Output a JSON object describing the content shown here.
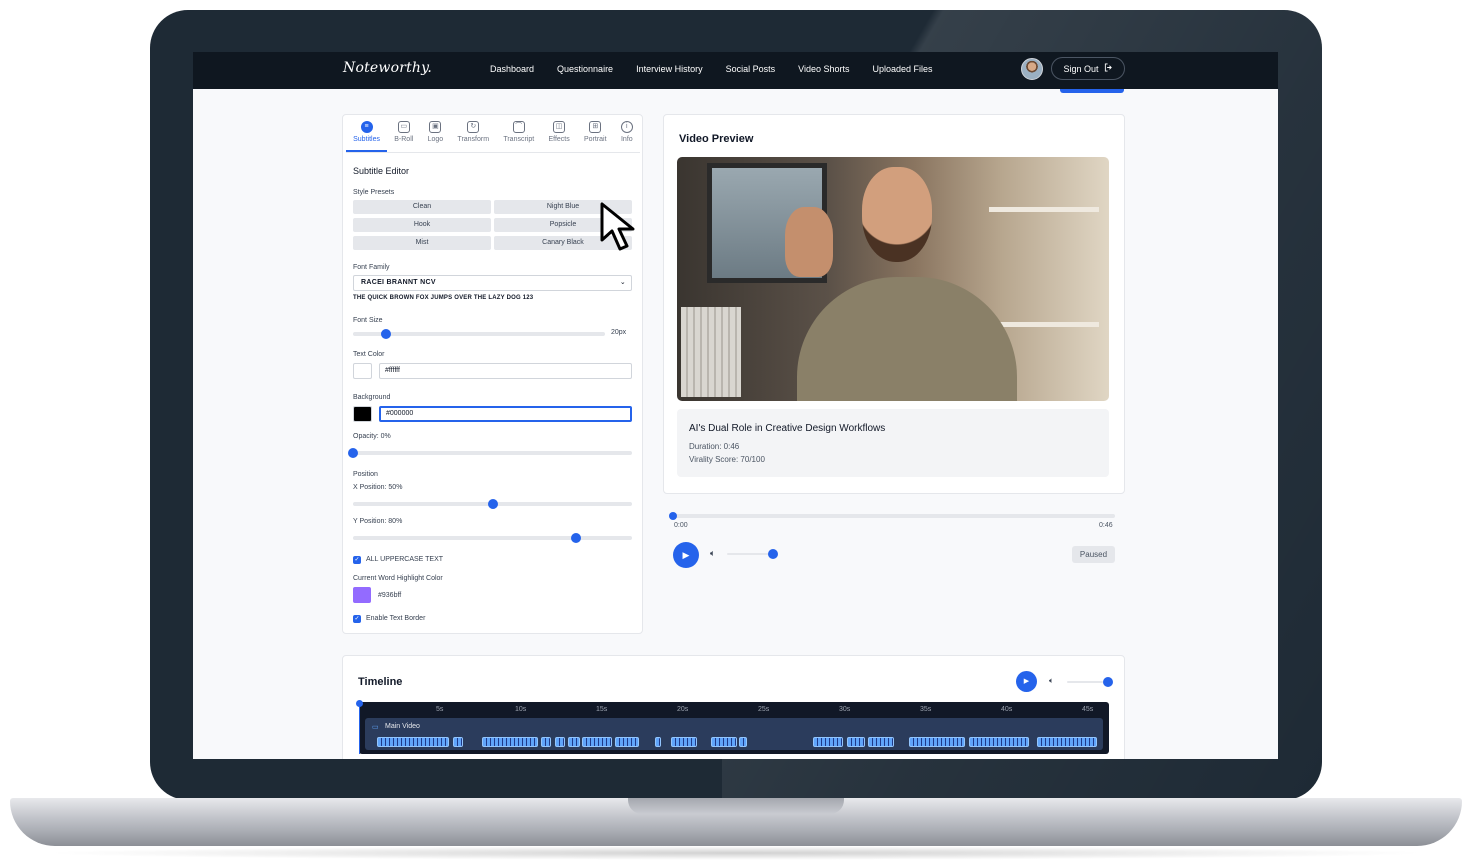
{
  "app": {
    "logo": "Noteworthy."
  },
  "nav": {
    "links": [
      "Dashboard",
      "Questionnaire",
      "Interview History",
      "Social Posts",
      "Video Shorts",
      "Uploaded Files"
    ],
    "sign_out": "Sign Out",
    "sign_out_icon": "logout-icon"
  },
  "tabs": [
    {
      "label": "Subtitles",
      "icon": "subtitles-icon",
      "active": true
    },
    {
      "label": "B-Roll",
      "icon": "camera-icon"
    },
    {
      "label": "Logo",
      "icon": "image-icon"
    },
    {
      "label": "Transform",
      "icon": "rotate-icon"
    },
    {
      "label": "Transcript",
      "icon": "transcript-icon"
    },
    {
      "label": "Effects",
      "icon": "effects-icon"
    },
    {
      "label": "Portrait",
      "icon": "grid-icon"
    },
    {
      "label": "Info",
      "icon": "info-icon"
    }
  ],
  "subtitle_editor": {
    "title": "Subtitle Editor",
    "style_presets_label": "Style Presets",
    "presets": [
      "Clean",
      "Night Blue",
      "Hook",
      "Popsicle",
      "Mist",
      "Canary Black"
    ],
    "font_family_label": "Font Family",
    "font_family_value": "RACEI BRANNT NCV",
    "font_sample": "THE QUICK BROWN FOX JUMPS OVER THE LAZY DOG 123",
    "font_size_label": "Font Size",
    "font_size_value": "20px",
    "font_size_fraction": 0.13,
    "text_color_label": "Text Color",
    "text_color_value": "#ffffff",
    "background_label": "Background",
    "background_value": "#000000",
    "opacity_label": "Opacity: 0%",
    "opacity_fraction": 0,
    "position_label": "Position",
    "x_position_label": "X Position: 50%",
    "x_position_fraction": 0.5,
    "y_position_label": "Y Position: 80%",
    "y_position_fraction": 0.8,
    "uppercase_label": "ALL UPPERCASE TEXT",
    "highlight_label": "Current Word Highlight Color",
    "highlight_value": "#936bff",
    "border_label": "Enable Text Border"
  },
  "preview": {
    "title": "Video Preview",
    "video_title": "AI's Dual Role in Creative Design Workflows",
    "duration": "Duration: 0:46",
    "virality": "Virality Score: 70/100"
  },
  "player": {
    "current_time": "0:00",
    "total_time": "0:46",
    "progress_fraction": 0,
    "volume_fraction": 1,
    "status": "Paused"
  },
  "timeline": {
    "title": "Timeline",
    "ticks": [
      "5s",
      "10s",
      "15s",
      "20s",
      "25s",
      "30s",
      "35s",
      "40s",
      "45s"
    ],
    "track_label": "Main Video"
  },
  "colors": {
    "accent": "#2563eb",
    "nav_bg": "#0f1720",
    "highlight": "#936bff"
  }
}
